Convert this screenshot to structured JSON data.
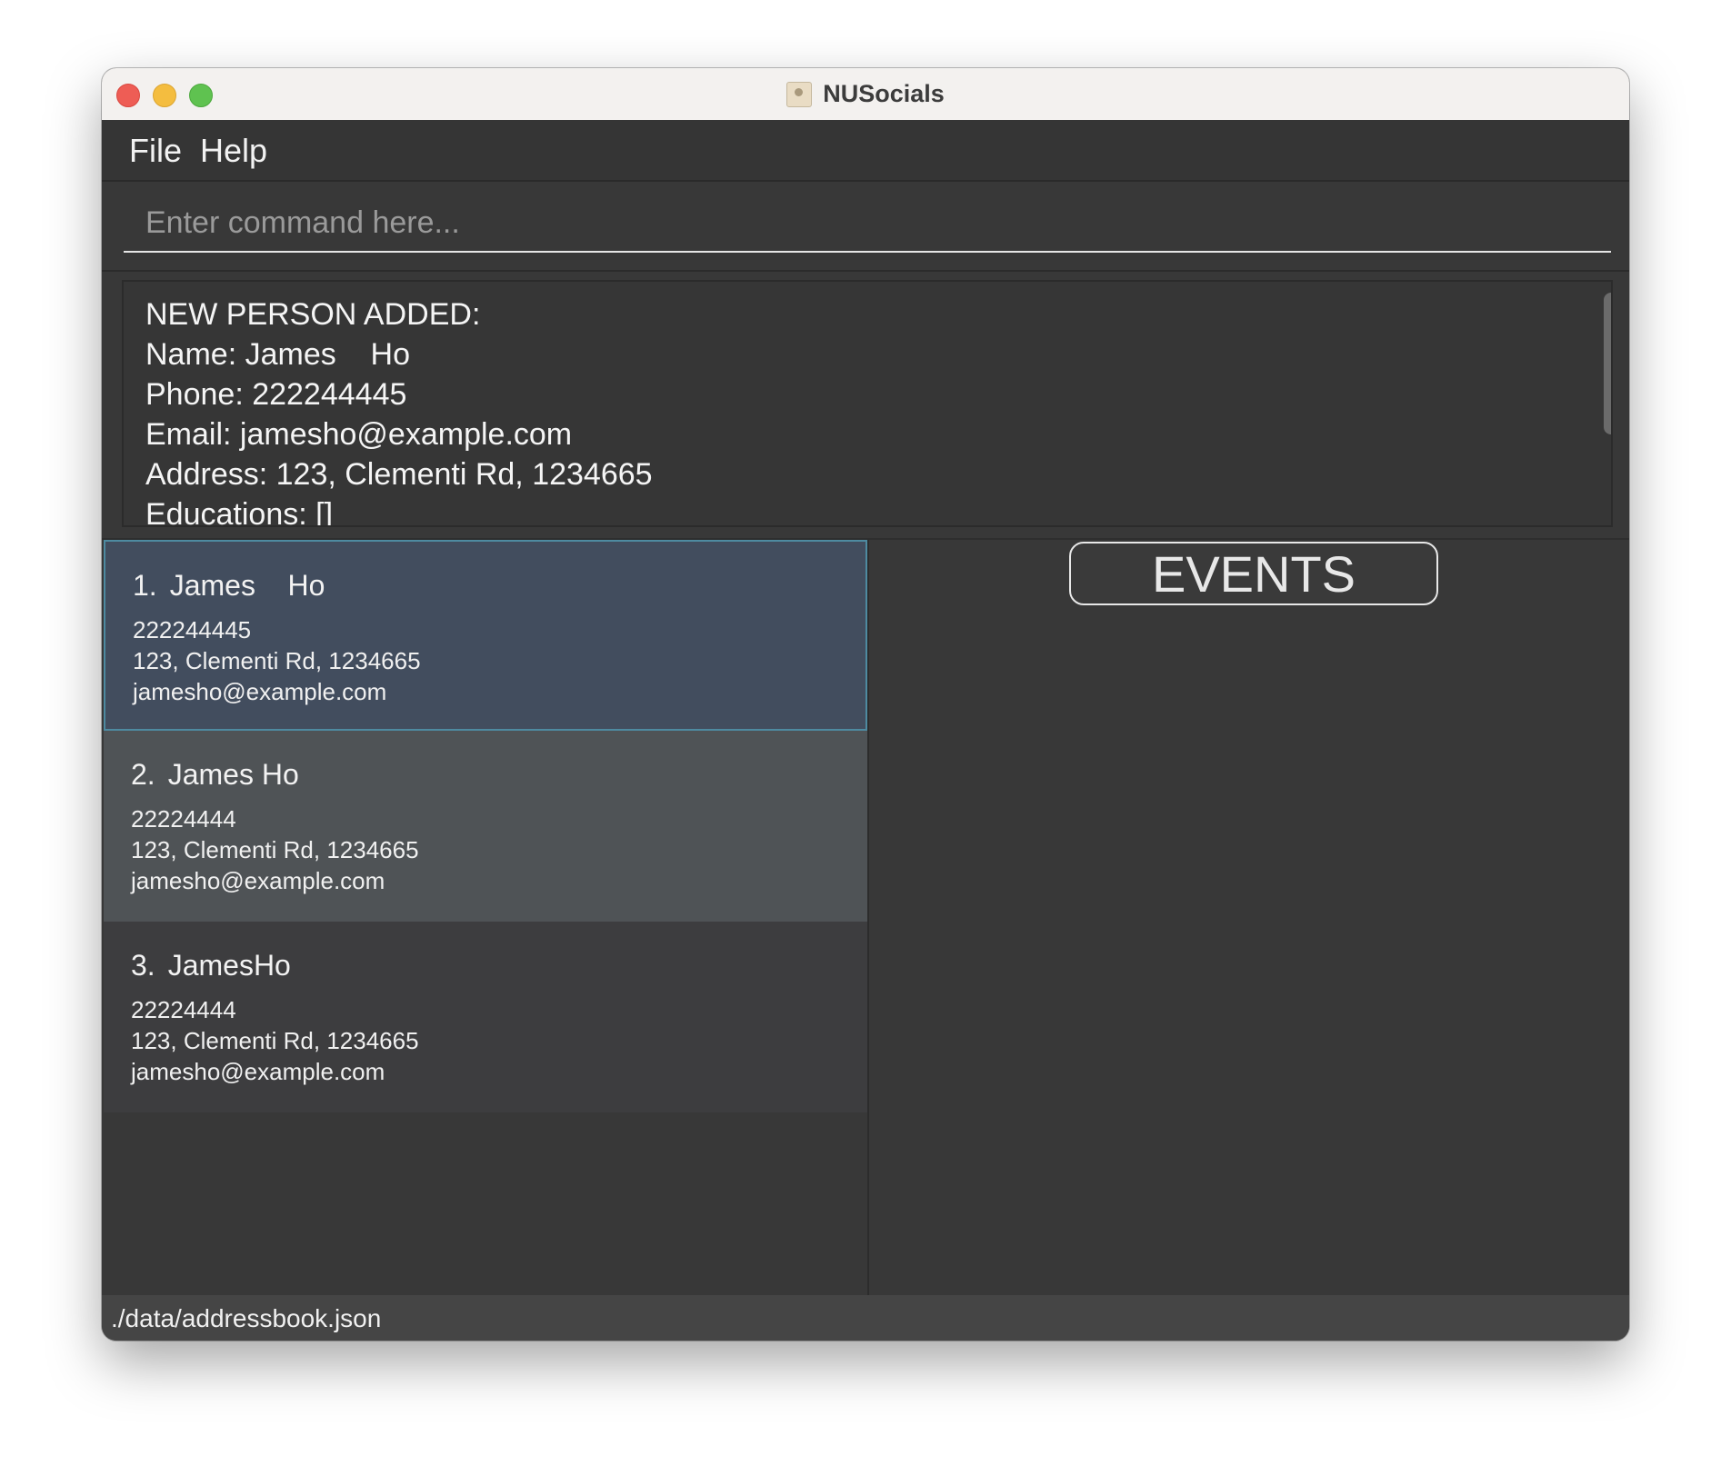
{
  "window": {
    "title": "NUSocials"
  },
  "menu": {
    "file": "File",
    "help": "Help"
  },
  "command": {
    "placeholder": "Enter command here...",
    "value": ""
  },
  "result": {
    "text": "NEW PERSON ADDED:\nName: James    Ho\nPhone: 222244445\nEmail: jamesho@example.com\nAddress: 123, Clementi Rd, 1234665\nEducations: []"
  },
  "persons": [
    {
      "index": "1.",
      "name": "James    Ho",
      "phone": "222244445",
      "address": "123, Clementi Rd, 1234665",
      "email": "jamesho@example.com",
      "selected": true
    },
    {
      "index": "2.",
      "name": "James Ho",
      "phone": "22224444",
      "address": "123, Clementi Rd, 1234665",
      "email": "jamesho@example.com",
      "selected": false
    },
    {
      "index": "3.",
      "name": "JamesHo",
      "phone": "22224444",
      "address": "123, Clementi Rd, 1234665",
      "email": "jamesho@example.com",
      "selected": false
    }
  ],
  "events": {
    "label": "EVENTS"
  },
  "status": {
    "path": "./data/addressbook.json"
  },
  "colors": {
    "selected_card": "#424d5e",
    "selected_border": "#4e8aa0",
    "alt_card": "#4f5356",
    "background": "#383838"
  },
  "icons": {
    "app": "address-book-icon"
  }
}
